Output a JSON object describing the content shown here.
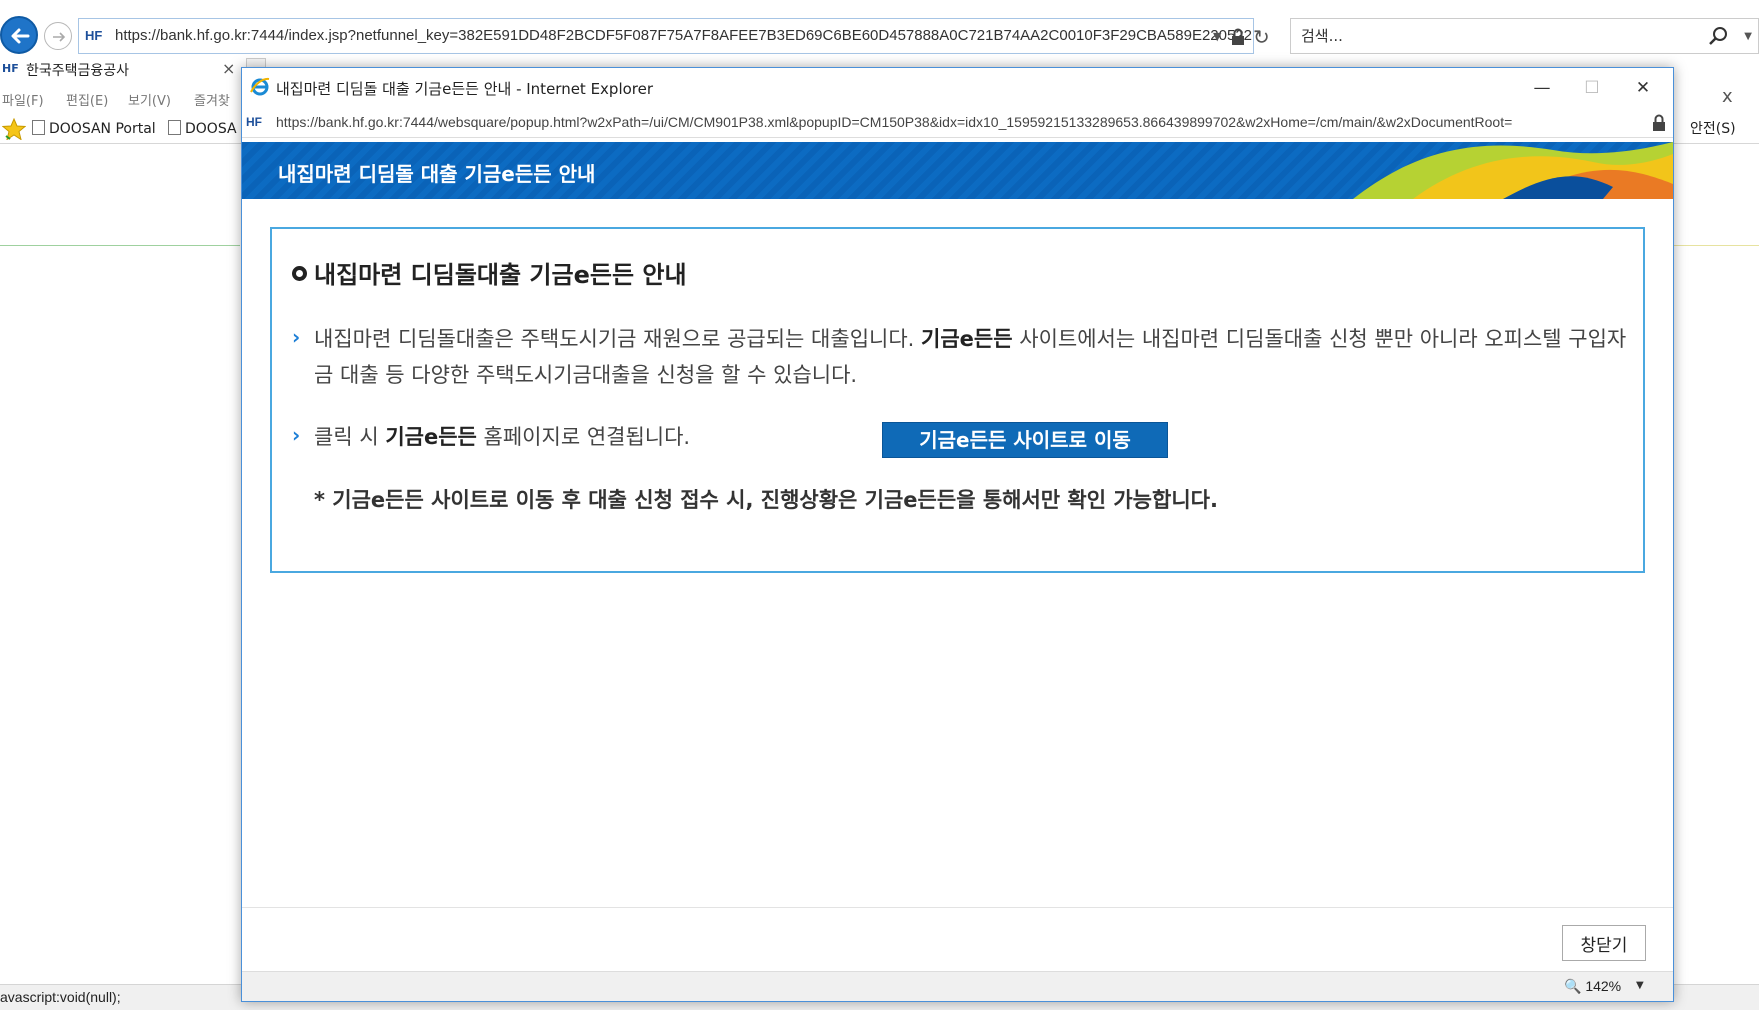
{
  "browser": {
    "url": "https://bank.hf.go.kr:7444/index.jsp?netfunnel_key=382E591DD48F2BCDF5F087F75A7F8AFEE7B3ED69C6BE60D457888A0C721B74AA2C0010F3F29CBA589E220522",
    "favicon_text": "HF",
    "search_placeholder": "검색...",
    "tab_title": "한국주택금융공사",
    "tab_close": "×",
    "menu": [
      "파일(F)",
      "편집(E)",
      "보기(V)",
      "즐겨찾"
    ],
    "favorites": [
      "DOOSAN Portal",
      "DOOSA"
    ],
    "safety_menu": "안전(S)",
    "close_x": "x",
    "status_text": "avascript:void(null);"
  },
  "popup": {
    "window_title": "내집마련 디딤돌 대출 기금e든든 안내 - Internet Explorer",
    "url": "https://bank.hf.go.kr:7444/websquare/popup.html?w2xPath=/ui/CM/CM901P38.xml&popupID=CM150P38&idx=idx10_15959215133289653.866439899702&w2xHome=/cm/main/&w2xDocumentRoot=",
    "favicon_text": "HF",
    "banner_title": "내집마련 디딤돌 대출 기금e든든 안내",
    "section_title": "내집마련 디딤돌대출 기금e든든 안내",
    "para1_a": "내집마련 디딤돌대출은 주택도시기금 재원으로 공급되는 대출입니다.",
    "para1_b": "기금e든든",
    "para1_c": "사이트에서는 내집마련 디딤돌대출 신청 뿐만 아니라 오피스텔 구입자금 대출 등 다양한 주택도시기금대출을 신청을 할 수 있습니다.",
    "para2_a": "클릭 시",
    "para2_b": "기금e든든",
    "para2_c": "홈페이지로 연결됩니다.",
    "go_button": "기금e든든 사이트로 이동",
    "note": "* 기금e든든 사이트로 이동 후 대출 신청 접수 시, 진행상황은 기금e든든을 통해서만 확인 가능합니다.",
    "close_button": "창닫기",
    "zoom": "142%",
    "window_controls": {
      "minimize": "—",
      "maximize": "☐",
      "close": "✕"
    }
  },
  "colors": {
    "banner_blue": "#0a63b8",
    "accent_blue": "#1c7ed6",
    "button_blue": "#0f6ab7",
    "box_border": "#4aa8e0"
  }
}
